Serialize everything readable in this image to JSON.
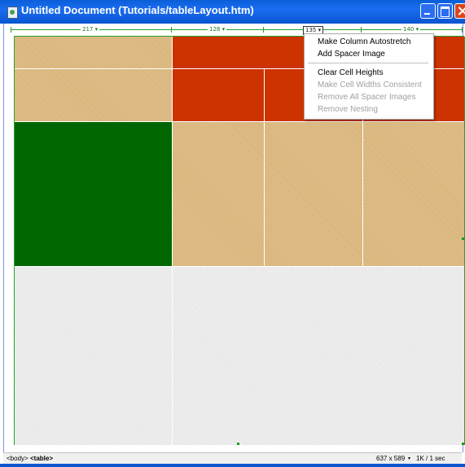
{
  "window": {
    "title": "Untitled Document (Tutorials/tableLayout.htm)",
    "icon": "document-icon"
  },
  "ruler": {
    "columns": [
      {
        "label": "217 ▾",
        "selected": false
      },
      {
        "label": "128 ▾",
        "selected": false
      },
      {
        "label": "135 ▾",
        "selected": true
      },
      {
        "label": "140 ▾",
        "selected": false
      }
    ]
  },
  "colors": {
    "tan": "#d9b57a",
    "red": "#cc3300",
    "green": "#006600",
    "grey": "#eeeeee",
    "guide": "#2aa02a"
  },
  "context_menu": {
    "items": [
      {
        "label": "Make Column Autostretch",
        "enabled": true
      },
      {
        "label": "Add Spacer Image",
        "enabled": true
      },
      {
        "label": "Clear Cell Heights",
        "enabled": true
      },
      {
        "label": "Make Cell Widths Consistent",
        "enabled": false
      },
      {
        "label": "Remove All Spacer Images",
        "enabled": false
      },
      {
        "label": "Remove Nesting",
        "enabled": false
      }
    ]
  },
  "statusbar": {
    "tag_body": "<body>",
    "tag_table": "<table>",
    "dimensions": "637 x 589",
    "size_time": "1K / 1 sec"
  }
}
